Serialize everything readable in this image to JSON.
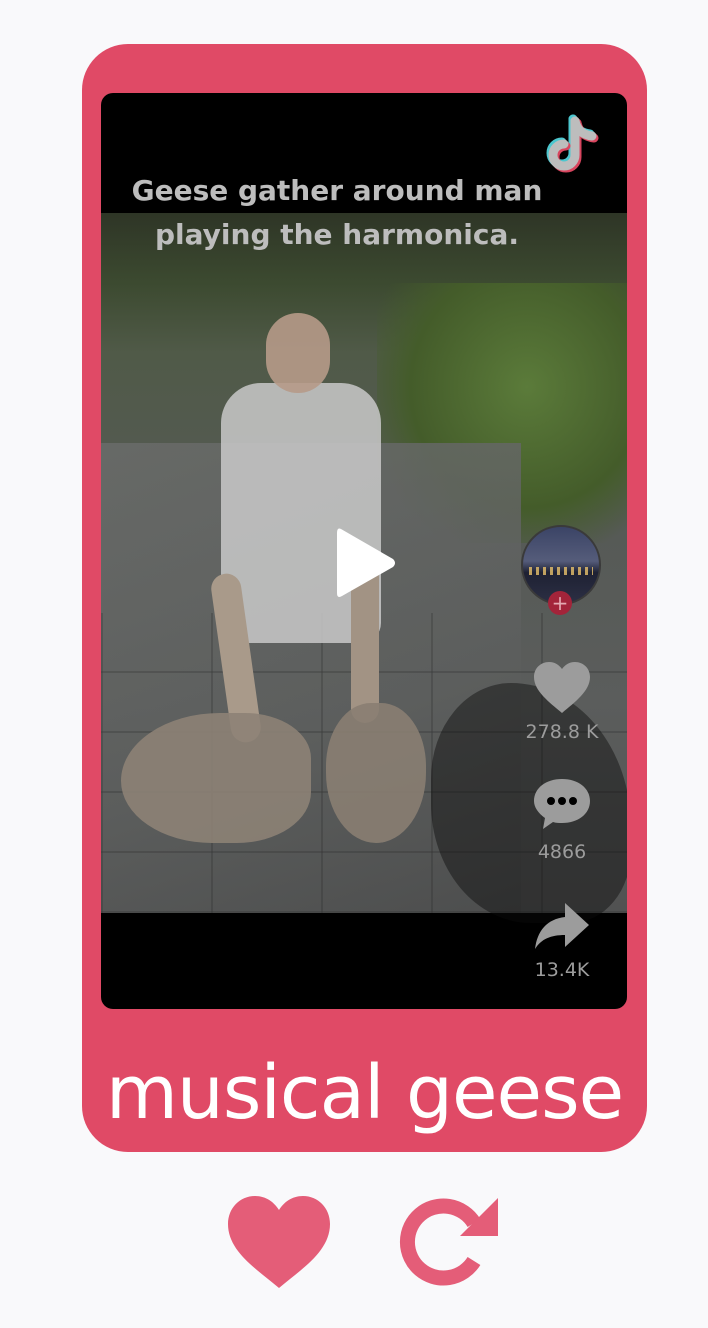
{
  "video": {
    "caption_line1": "Geese gather around man",
    "caption_line2": "playing the harmonica.",
    "likes": "278.8 K",
    "comments": "4866",
    "shares": "13.4K",
    "follow_symbol": "+"
  },
  "card": {
    "title": "musical geese"
  },
  "colors": {
    "card": "#e04a66",
    "background": "#f9f9fb",
    "video_bg": "#000000",
    "icon_gray": "#9c9c9c"
  },
  "icons": [
    "tiktok-logo-icon",
    "play-icon",
    "heart-icon",
    "comment-icon",
    "share-icon",
    "like-button-heart-icon",
    "refresh-icon"
  ]
}
